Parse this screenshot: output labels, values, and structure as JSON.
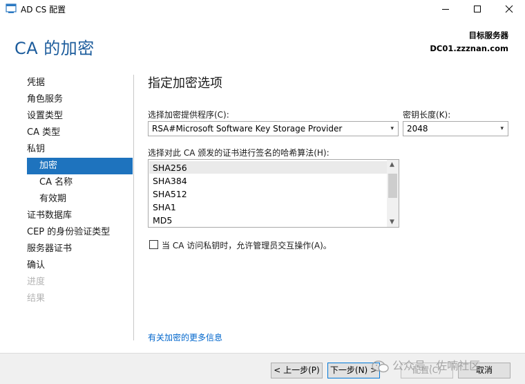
{
  "window": {
    "title": "AD CS 配置"
  },
  "header": {
    "page_title": "CA 的加密",
    "target_label": "目标服务器",
    "target_server": "DC01.zzznan.com"
  },
  "nav": {
    "items": [
      {
        "label": "凭据",
        "state": "normal"
      },
      {
        "label": "角色服务",
        "state": "normal"
      },
      {
        "label": "设置类型",
        "state": "normal"
      },
      {
        "label": "CA 类型",
        "state": "normal"
      },
      {
        "label": "私钥",
        "state": "normal"
      },
      {
        "label": "加密",
        "state": "active"
      },
      {
        "label": "CA 名称",
        "state": "sub"
      },
      {
        "label": "有效期",
        "state": "sub"
      },
      {
        "label": "证书数据库",
        "state": "normal"
      },
      {
        "label": "CEP 的身份验证类型",
        "state": "normal"
      },
      {
        "label": "服务器证书",
        "state": "normal"
      },
      {
        "label": "确认",
        "state": "normal"
      },
      {
        "label": "进度",
        "state": "disabled"
      },
      {
        "label": "结果",
        "state": "disabled"
      }
    ]
  },
  "main": {
    "section_title": "指定加密选项",
    "provider_label": "选择加密提供程序(C):",
    "provider_value": "RSA#Microsoft Software Key Storage Provider",
    "keylen_label": "密钥长度(K):",
    "keylen_value": "2048",
    "hash_label": "选择对此 CA 颁发的证书进行签名的哈希算法(H):",
    "hash_options": [
      "SHA256",
      "SHA384",
      "SHA512",
      "SHA1",
      "MD5"
    ],
    "allow_admin_label": "当 CA 访问私钥时，允许管理员交互操作(A)。",
    "more_info_link": "有关加密的更多信息"
  },
  "footer": {
    "prev": "< 上一步(P)",
    "next": "下一步(N) >",
    "configure": "配置(C)",
    "cancel": "取消"
  },
  "watermark": {
    "text": "公众号 · 佐喃社区"
  },
  "colors": {
    "accent": "#1e73be",
    "title": "#1c5c9c",
    "link": "#0066cc"
  }
}
